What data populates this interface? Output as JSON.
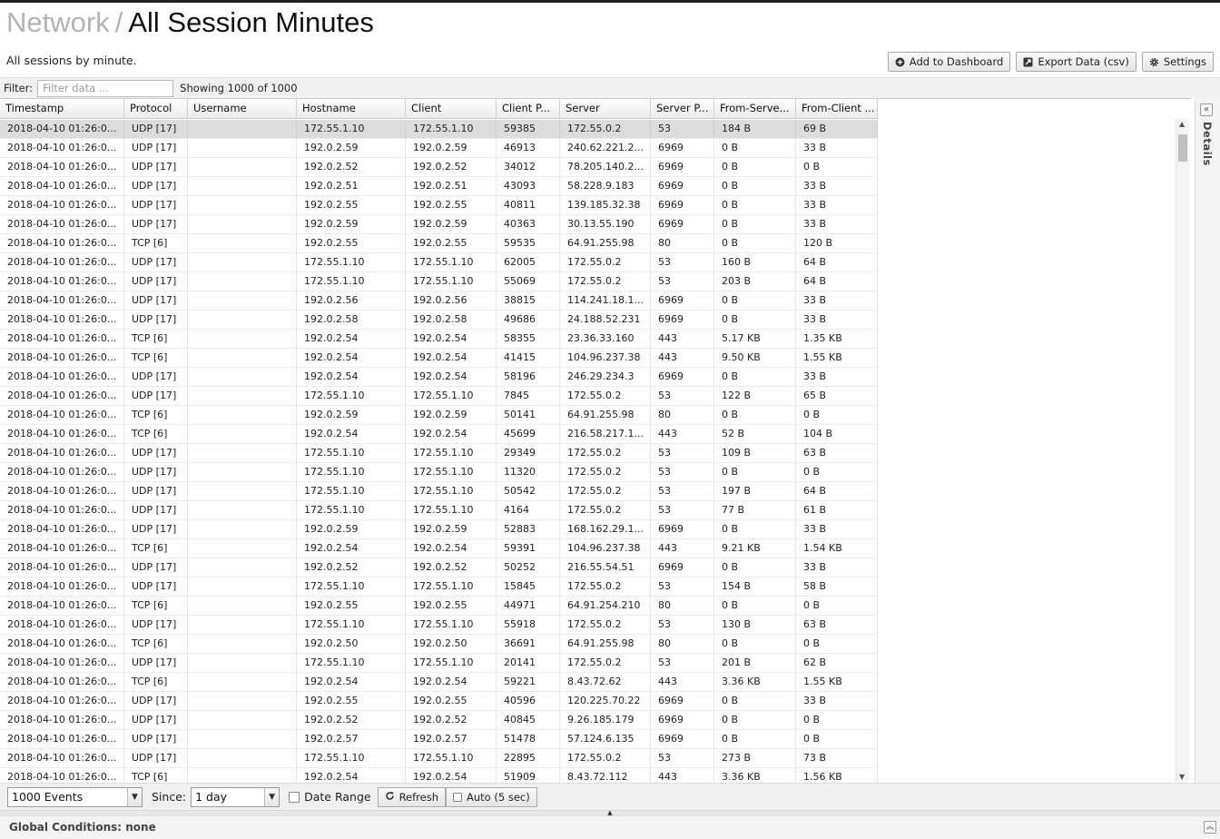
{
  "header": {
    "breadcrumb": "Network",
    "separator": "/",
    "title": "All Session Minutes",
    "subtitle": "All sessions by minute."
  },
  "toolbar": {
    "add_dashboard": "Add to Dashboard",
    "export": "Export Data (csv)",
    "settings": "Settings"
  },
  "filter": {
    "label": "Filter:",
    "placeholder": "Filter data ...",
    "showing": "Showing 1000 of 1000"
  },
  "columns": [
    "Timestamp",
    "Protocol",
    "Username",
    "Hostname",
    "Client",
    "Client P...",
    "Server",
    "Server P...",
    "From-Serve...",
    "From-Client ..."
  ],
  "rows": [
    [
      "2018-04-10 01:26:0...",
      "UDP [17]",
      "",
      "172.55.1.10",
      "172.55.1.10",
      "59385",
      "172.55.0.2",
      "53",
      "184 B",
      "69 B"
    ],
    [
      "2018-04-10 01:26:0...",
      "UDP [17]",
      "",
      "192.0.2.59",
      "192.0.2.59",
      "46913",
      "240.62.221.2...",
      "6969",
      "0 B",
      "33 B"
    ],
    [
      "2018-04-10 01:26:0...",
      "UDP [17]",
      "",
      "192.0.2.52",
      "192.0.2.52",
      "34012",
      "78.205.140.2...",
      "6969",
      "0 B",
      "0 B"
    ],
    [
      "2018-04-10 01:26:0...",
      "UDP [17]",
      "",
      "192.0.2.51",
      "192.0.2.51",
      "43093",
      "58.228.9.183",
      "6969",
      "0 B",
      "33 B"
    ],
    [
      "2018-04-10 01:26:0...",
      "UDP [17]",
      "",
      "192.0.2.55",
      "192.0.2.55",
      "40811",
      "139.185.32.38",
      "6969",
      "0 B",
      "33 B"
    ],
    [
      "2018-04-10 01:26:0...",
      "UDP [17]",
      "",
      "192.0.2.59",
      "192.0.2.59",
      "40363",
      "30.13.55.190",
      "6969",
      "0 B",
      "33 B"
    ],
    [
      "2018-04-10 01:26:0...",
      "TCP [6]",
      "",
      "192.0.2.55",
      "192.0.2.55",
      "59535",
      "64.91.255.98",
      "80",
      "0 B",
      "120 B"
    ],
    [
      "2018-04-10 01:26:0...",
      "UDP [17]",
      "",
      "172.55.1.10",
      "172.55.1.10",
      "62005",
      "172.55.0.2",
      "53",
      "160 B",
      "64 B"
    ],
    [
      "2018-04-10 01:26:0...",
      "UDP [17]",
      "",
      "172.55.1.10",
      "172.55.1.10",
      "55069",
      "172.55.0.2",
      "53",
      "203 B",
      "64 B"
    ],
    [
      "2018-04-10 01:26:0...",
      "UDP [17]",
      "",
      "192.0.2.56",
      "192.0.2.56",
      "38815",
      "114.241.18.1...",
      "6969",
      "0 B",
      "33 B"
    ],
    [
      "2018-04-10 01:26:0...",
      "UDP [17]",
      "",
      "192.0.2.58",
      "192.0.2.58",
      "49686",
      "24.188.52.231",
      "6969",
      "0 B",
      "33 B"
    ],
    [
      "2018-04-10 01:26:0...",
      "TCP [6]",
      "",
      "192.0.2.54",
      "192.0.2.54",
      "58355",
      "23.36.33.160",
      "443",
      "5.17 KB",
      "1.35 KB"
    ],
    [
      "2018-04-10 01:26:0...",
      "TCP [6]",
      "",
      "192.0.2.54",
      "192.0.2.54",
      "41415",
      "104.96.237.38",
      "443",
      "9.50 KB",
      "1.55 KB"
    ],
    [
      "2018-04-10 01:26:0...",
      "UDP [17]",
      "",
      "192.0.2.54",
      "192.0.2.54",
      "58196",
      "246.29.234.3",
      "6969",
      "0 B",
      "33 B"
    ],
    [
      "2018-04-10 01:26:0...",
      "UDP [17]",
      "",
      "172.55.1.10",
      "172.55.1.10",
      "7845",
      "172.55.0.2",
      "53",
      "122 B",
      "65 B"
    ],
    [
      "2018-04-10 01:26:0...",
      "TCP [6]",
      "",
      "192.0.2.59",
      "192.0.2.59",
      "50141",
      "64.91.255.98",
      "80",
      "0 B",
      "0 B"
    ],
    [
      "2018-04-10 01:26:0...",
      "TCP [6]",
      "",
      "192.0.2.54",
      "192.0.2.54",
      "45699",
      "216.58.217.1...",
      "443",
      "52 B",
      "104 B"
    ],
    [
      "2018-04-10 01:26:0...",
      "UDP [17]",
      "",
      "172.55.1.10",
      "172.55.1.10",
      "29349",
      "172.55.0.2",
      "53",
      "109 B",
      "63 B"
    ],
    [
      "2018-04-10 01:26:0...",
      "UDP [17]",
      "",
      "172.55.1.10",
      "172.55.1.10",
      "11320",
      "172.55.0.2",
      "53",
      "0 B",
      "0 B"
    ],
    [
      "2018-04-10 01:26:0...",
      "UDP [17]",
      "",
      "172.55.1.10",
      "172.55.1.10",
      "50542",
      "172.55.0.2",
      "53",
      "197 B",
      "64 B"
    ],
    [
      "2018-04-10 01:26:0...",
      "UDP [17]",
      "",
      "172.55.1.10",
      "172.55.1.10",
      "4164",
      "172.55.0.2",
      "53",
      "77 B",
      "61 B"
    ],
    [
      "2018-04-10 01:26:0...",
      "UDP [17]",
      "",
      "192.0.2.59",
      "192.0.2.59",
      "52883",
      "168.162.29.1...",
      "6969",
      "0 B",
      "33 B"
    ],
    [
      "2018-04-10 01:26:0...",
      "TCP [6]",
      "",
      "192.0.2.54",
      "192.0.2.54",
      "59391",
      "104.96.237.38",
      "443",
      "9.21 KB",
      "1.54 KB"
    ],
    [
      "2018-04-10 01:26:0...",
      "UDP [17]",
      "",
      "192.0.2.52",
      "192.0.2.52",
      "50252",
      "216.55.54.51",
      "6969",
      "0 B",
      "33 B"
    ],
    [
      "2018-04-10 01:26:0...",
      "UDP [17]",
      "",
      "172.55.1.10",
      "172.55.1.10",
      "15845",
      "172.55.0.2",
      "53",
      "154 B",
      "58 B"
    ],
    [
      "2018-04-10 01:26:0...",
      "TCP [6]",
      "",
      "192.0.2.55",
      "192.0.2.55",
      "44971",
      "64.91.254.210",
      "80",
      "0 B",
      "0 B"
    ],
    [
      "2018-04-10 01:26:0...",
      "UDP [17]",
      "",
      "172.55.1.10",
      "172.55.1.10",
      "55918",
      "172.55.0.2",
      "53",
      "130 B",
      "63 B"
    ],
    [
      "2018-04-10 01:26:0...",
      "TCP [6]",
      "",
      "192.0.2.50",
      "192.0.2.50",
      "36691",
      "64.91.255.98",
      "80",
      "0 B",
      "0 B"
    ],
    [
      "2018-04-10 01:26:0...",
      "UDP [17]",
      "",
      "172.55.1.10",
      "172.55.1.10",
      "20141",
      "172.55.0.2",
      "53",
      "201 B",
      "62 B"
    ],
    [
      "2018-04-10 01:26:0...",
      "TCP [6]",
      "",
      "192.0.2.54",
      "192.0.2.54",
      "59221",
      "8.43.72.62",
      "443",
      "3.36 KB",
      "1.55 KB"
    ],
    [
      "2018-04-10 01:26:0...",
      "UDP [17]",
      "",
      "192.0.2.55",
      "192.0.2.55",
      "40596",
      "120.225.70.22",
      "6969",
      "0 B",
      "33 B"
    ],
    [
      "2018-04-10 01:26:0...",
      "UDP [17]",
      "",
      "192.0.2.52",
      "192.0.2.52",
      "40845",
      "9.26.185.179",
      "6969",
      "0 B",
      "0 B"
    ],
    [
      "2018-04-10 01:26:0...",
      "UDP [17]",
      "",
      "192.0.2.57",
      "192.0.2.57",
      "51478",
      "57.124.6.135",
      "6969",
      "0 B",
      "0 B"
    ],
    [
      "2018-04-10 01:26:0...",
      "UDP [17]",
      "",
      "172.55.1.10",
      "172.55.1.10",
      "22895",
      "172.55.0.2",
      "53",
      "273 B",
      "73 B"
    ],
    [
      "2018-04-10 01:26:0...",
      "TCP [6]",
      "",
      "192.0.2.54",
      "192.0.2.54",
      "51909",
      "8.43.72.112",
      "443",
      "3.36 KB",
      "1.56 KB"
    ]
  ],
  "details_label": "Details",
  "bottom": {
    "events_value": "1000 Events",
    "since_label": "Since:",
    "since_value": "1 day",
    "date_range": "Date Range",
    "refresh": "Refresh",
    "auto": "Auto (5 sec)"
  },
  "global": {
    "title": "Global Conditions: none"
  },
  "icons": {
    "add": "plus-circle-icon",
    "export": "external-link-icon",
    "settings": "gear-icon",
    "refresh": "refresh-icon",
    "collapse": "double-chevron-icon"
  },
  "colors": {
    "selected_row": "#dcdcdc",
    "breadcrumb": "#b3b3b3"
  }
}
